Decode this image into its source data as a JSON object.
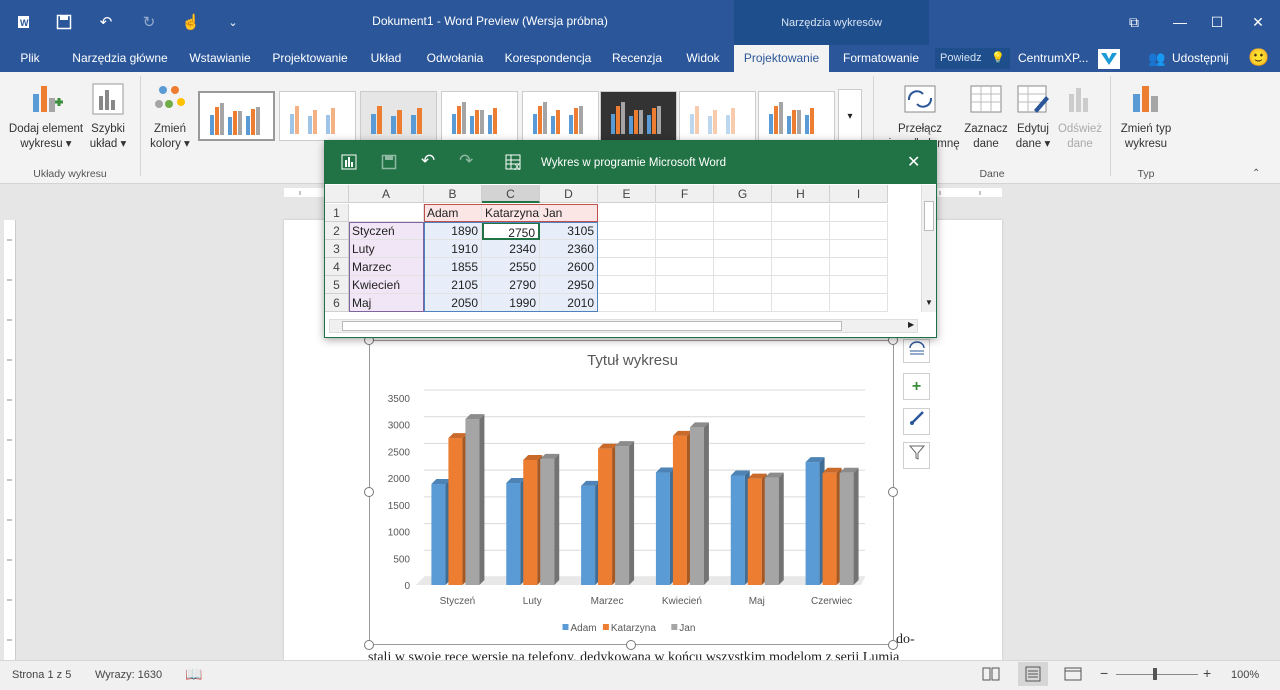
{
  "window": {
    "title": "Dokument1 - Word Preview (Wersja próbna)",
    "context_tab": "Narzędzia wykresów"
  },
  "tabs": [
    "Plik",
    "Narzędzia główne",
    "Wstawianie",
    "Projektowanie",
    "Układ",
    "Odwołania",
    "Korespondencja",
    "Recenzja",
    "Widok",
    "Projektowanie",
    "Formatowanie"
  ],
  "tell_me": "Powiedz",
  "account": "CentrumXP...",
  "share": "Udostępnij",
  "ribbon": {
    "add_element": "Dodaj element wykresu",
    "quick_layout": "Szybki układ",
    "change_colors": "Zmień kolory",
    "group_layouts": "Układy wykresu",
    "switch_row": "Przełącz wiersz/kolumnę",
    "select_data": "Zaznacz dane",
    "edit_data": "Edytuj dane",
    "refresh_data": "Odśwież dane",
    "group_data": "Dane",
    "change_type": "Zmień typ wykresu",
    "group_type": "Typ"
  },
  "excel": {
    "title": "Wykres w programie Microsoft Word",
    "columns": [
      "A",
      "B",
      "C",
      "D",
      "E",
      "F",
      "G",
      "H",
      "I"
    ],
    "rows": [
      [
        "",
        "Adam",
        "Katarzyna",
        "Jan"
      ],
      [
        "Styczeń",
        "1890",
        "2750",
        "3105"
      ],
      [
        "Luty",
        "1910",
        "2340",
        "2360"
      ],
      [
        "Marzec",
        "1855",
        "2550",
        "2600"
      ],
      [
        "Kwiecień",
        "2105",
        "2790",
        "2950"
      ],
      [
        "Maj",
        "2050",
        "1990",
        "2010"
      ]
    ]
  },
  "chart_data": {
    "type": "bar",
    "title": "Tytuł wykresu",
    "categories": [
      "Styczeń",
      "Luty",
      "Marzec",
      "Kwiecień",
      "Maj",
      "Czerwiec"
    ],
    "series": [
      {
        "name": "Adam",
        "values": [
          1890,
          1910,
          1855,
          2105,
          2050,
          2300
        ],
        "color": "#5b9bd5"
      },
      {
        "name": "Katarzyna",
        "values": [
          2750,
          2340,
          2550,
          2790,
          1990,
          2100
        ],
        "color": "#ed7d31"
      },
      {
        "name": "Jan",
        "values": [
          3105,
          2360,
          2600,
          2950,
          2010,
          2100
        ],
        "color": "#a5a5a5"
      }
    ],
    "ylim": [
      0,
      3500
    ],
    "yticks": [
      "3500",
      "3000",
      "2500",
      "2000",
      "1500",
      "1000",
      "500",
      "0"
    ],
    "legend": "bottom",
    "grid": true
  },
  "document": {
    "text_right": "do-",
    "text_line": "stali w swoje ręce wersję na telefony, dedykowaną w końcu wszystkim modelom z serii Lumia"
  },
  "status": {
    "page": "Strona 1 z 5",
    "words": "Wyrazy: 1630",
    "zoom": "100%"
  }
}
